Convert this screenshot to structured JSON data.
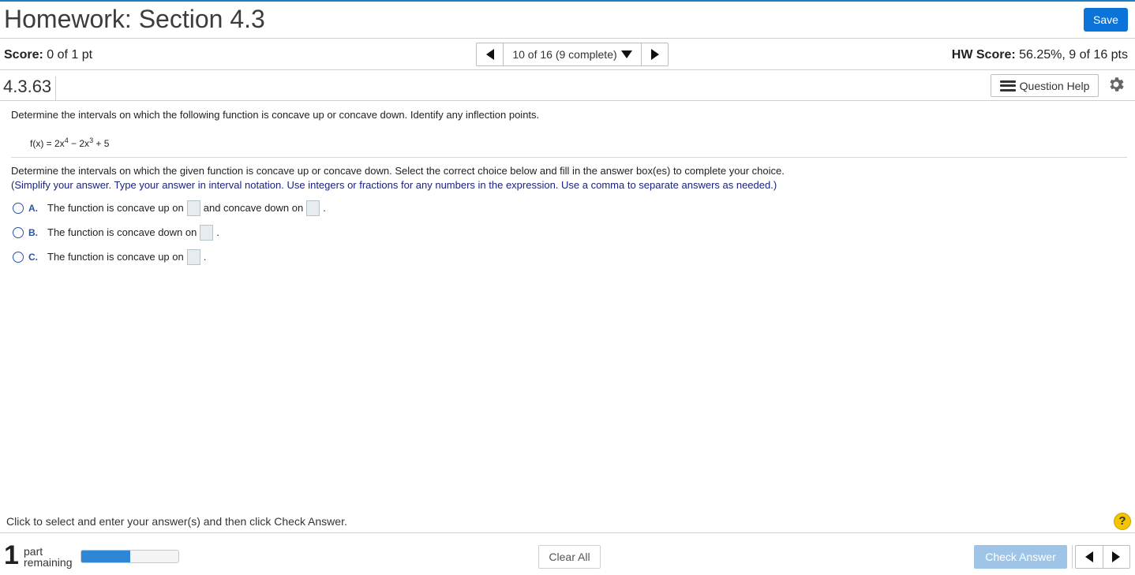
{
  "header": {
    "title": "Homework: Section 4.3",
    "save_label": "Save"
  },
  "score": {
    "label": "Score:",
    "value": "0 of 1 pt",
    "hw_label": "HW Score:",
    "hw_value": "56.25%, 9 of 16 pts"
  },
  "nav": {
    "position": "10 of 16 (9 complete)"
  },
  "question": {
    "number": "4.3.63",
    "help_label": "Question Help",
    "prompt": "Determine the intervals on which the following function is concave up or concave down. Identify any inflection points.",
    "function": {
      "lhs": "f(x) = 2x",
      "exp1": "4",
      "mid": " − 2x",
      "exp2": "3",
      "rhs": " + 5"
    },
    "instruction": "Determine the intervals on which the given function is concave up or concave down. Select the correct choice below and fill in the answer box(es) to complete your choice.",
    "instruction_note": "(Simplify your answer. Type your answer in interval notation. Use integers or fractions for any numbers in the expression. Use a comma to separate answers as needed.)",
    "choices": [
      {
        "letter": "A.",
        "text1": "The function is concave up on",
        "text2": "and concave down on",
        "end": "."
      },
      {
        "letter": "B.",
        "text1": "The function is concave down on",
        "end": "."
      },
      {
        "letter": "C.",
        "text1": "The function is concave up on",
        "end": "."
      }
    ]
  },
  "footer": {
    "note": "Click to select and enter your answer(s) and then click Check Answer.",
    "help_icon": "?",
    "parts_count": "1",
    "parts_line1": "part",
    "parts_line2": "remaining",
    "progress_fraction": 0.5,
    "clear_label": "Clear All",
    "check_label": "Check Answer"
  },
  "colors": {
    "accent": "#0b74d8",
    "choice_letter": "#2952a3",
    "note_text": "#1a237e",
    "progress": "#2e86d4",
    "check_disabled": "#9ec5e8"
  }
}
